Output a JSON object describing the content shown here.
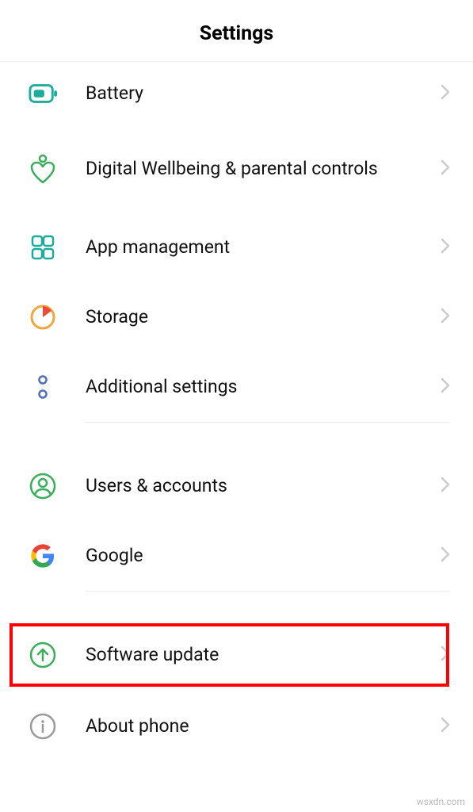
{
  "header": {
    "title": "Settings"
  },
  "items": {
    "battery": {
      "label": "Battery"
    },
    "wellbeing": {
      "label": "Digital Wellbeing & parental controls"
    },
    "apps": {
      "label": "App management"
    },
    "storage": {
      "label": "Storage"
    },
    "additional": {
      "label": "Additional settings"
    },
    "users": {
      "label": "Users & accounts"
    },
    "google": {
      "label": "Google"
    },
    "software": {
      "label": "Software update"
    },
    "about": {
      "label": "About phone"
    }
  },
  "watermark": "wsxdn.com",
  "colors": {
    "teal": "#1cac9c",
    "green": "#3aae5c",
    "orange": "#f0a83e",
    "blue": "#4f6fb2",
    "gray": "#9a9a9a",
    "google_blue": "#4285F4",
    "google_red": "#EA4335",
    "google_yellow": "#FBBC05",
    "google_green": "#34A853"
  }
}
